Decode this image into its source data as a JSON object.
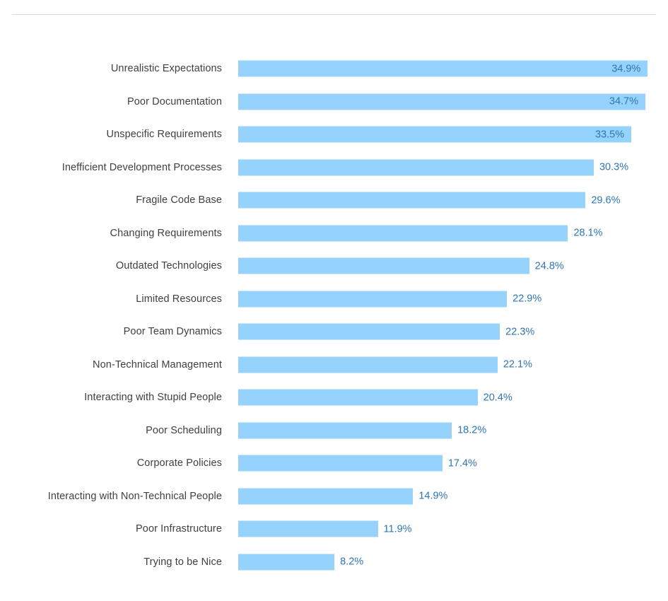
{
  "chart_data": {
    "type": "bar",
    "orientation": "horizontal",
    "title": "",
    "subtitle": "",
    "xlabel": "",
    "ylabel": "",
    "xlim": [
      0,
      35.5
    ],
    "grid": false,
    "legend": false,
    "legend_position": "none",
    "value_suffix": "%",
    "bar_color": "#95d3fc",
    "value_label_color": "#2e75b6",
    "category_label_color": "#404040",
    "divider_color": "#d9d9d9",
    "background_color": "#ffffff",
    "categories": [
      "Unrealistic Expectations",
      "Poor Documentation",
      "Unspecific Requirements",
      "Inefficient Development Processes",
      "Fragile Code Base",
      "Changing Requirements",
      "Outdated Technologies",
      "Limited Resources",
      "Poor Team Dynamics",
      "Non-Technical Management",
      "Interacting with Stupid People",
      "Poor Scheduling",
      "Corporate Policies",
      "Interacting with Non-Technical People",
      "Poor Infrastructure",
      "Trying to be Nice"
    ],
    "values": [
      34.9,
      34.7,
      33.5,
      30.3,
      29.6,
      28.1,
      24.8,
      22.9,
      22.3,
      22.1,
      20.4,
      18.2,
      17.4,
      14.9,
      11.9,
      8.2
    ],
    "value_labels": [
      "34.9%",
      "34.7%",
      "33.5%",
      "30.3%",
      "29.6%",
      "28.1%",
      "24.8%",
      "22.9%",
      "22.3%",
      "22.1%",
      "20.4%",
      "18.2%",
      "17.4%",
      "14.9%",
      "11.9%",
      "8.2%"
    ],
    "label_placement": [
      "inside",
      "inside",
      "inside",
      "outside",
      "outside",
      "outside",
      "outside",
      "outside",
      "outside",
      "outside",
      "outside",
      "outside",
      "outside",
      "outside",
      "outside",
      "outside"
    ]
  }
}
